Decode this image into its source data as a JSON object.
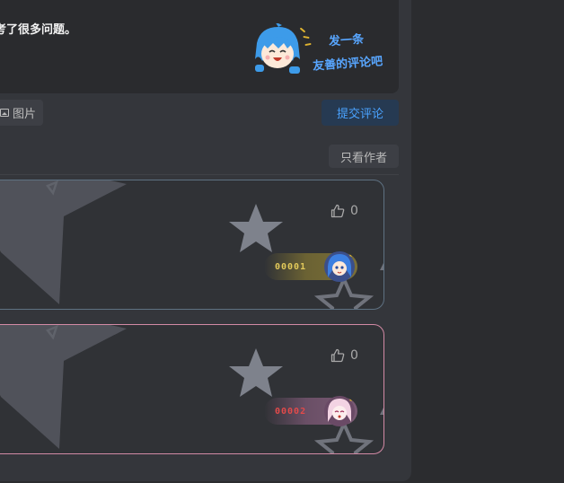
{
  "editor": {
    "text": "考了很多问题。",
    "prompt_line1": "发一条",
    "prompt_line2": "友善的评论吧"
  },
  "toolbar": {
    "image_label": "图片",
    "submit_label": "提交评论"
  },
  "filter": {
    "author_only_label": "只看作者"
  },
  "comments": [
    {
      "likes": "0",
      "badge_number": "00001",
      "badge_color": "#e2c95a",
      "border_color": "#5e7182"
    },
    {
      "likes": "0",
      "badge_number": "00002",
      "badge_color": "#e24a4a",
      "border_color": "#d28aa5"
    }
  ],
  "colors": {
    "accent": "#4aa3ff",
    "prompt": "#58a6ff",
    "background": "#2b2c2f",
    "panel": "#34363b"
  }
}
